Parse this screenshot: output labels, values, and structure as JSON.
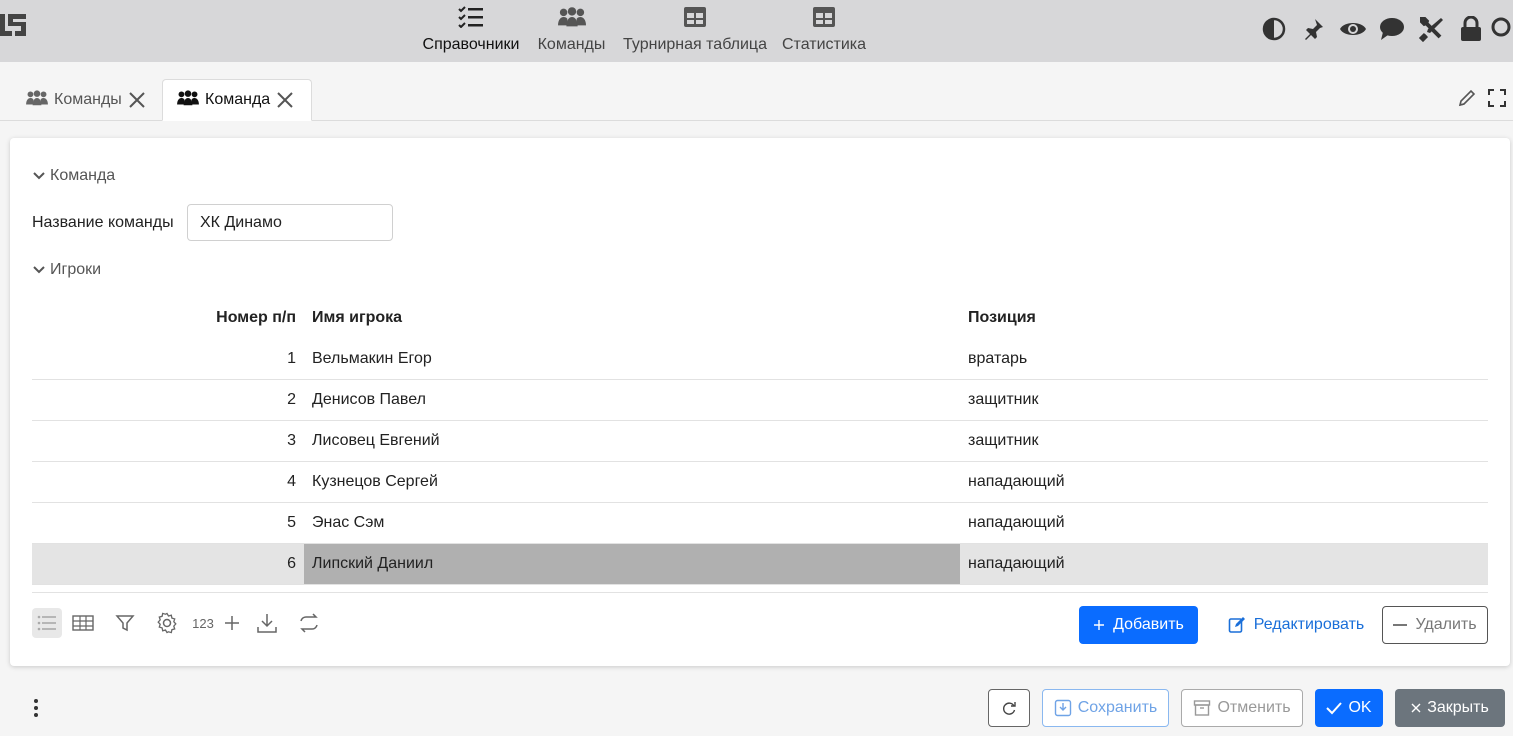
{
  "nav": [
    {
      "label": "Справочники",
      "icon": "checklist-icon",
      "active": true
    },
    {
      "label": "Команды",
      "icon": "users-icon",
      "active": false
    },
    {
      "label": "Турнирная таблица",
      "icon": "table-icon",
      "active": false
    },
    {
      "label": "Статистика",
      "icon": "table-icon",
      "active": false
    }
  ],
  "tools": [
    "contrast-icon",
    "pin-icon",
    "eye-icon",
    "comment-icon",
    "tools-icon",
    "lock-icon",
    "search-icon"
  ],
  "tabs": [
    {
      "label": "Команды",
      "active": false
    },
    {
      "label": "Команда",
      "active": true
    }
  ],
  "form": {
    "section_team": "Команда",
    "team_name_label": "Название команды",
    "team_name_value": "ХК Динамо",
    "section_players": "Игроки"
  },
  "grid": {
    "columns": [
      "Номер п/п",
      "Имя игрока",
      "Позиция"
    ],
    "rows": [
      {
        "num": "1",
        "name": "Вельмакин Егор",
        "position": "вратарь"
      },
      {
        "num": "2",
        "name": "Денисов Павел",
        "position": "защитник"
      },
      {
        "num": "3",
        "name": "Лисовец Евгений",
        "position": "защитник"
      },
      {
        "num": "4",
        "name": "Кузнецов Сергей",
        "position": "нападающий"
      },
      {
        "num": "5",
        "name": "Энас Сэм",
        "position": "нападающий"
      },
      {
        "num": "6",
        "name": "Липский Даниил",
        "position": "нападающий"
      }
    ],
    "selected_row": 5,
    "toolbar_count_label": "123"
  },
  "buttons": {
    "add": "Добавить",
    "edit": "Редактировать",
    "delete": "Удалить"
  },
  "footer": {
    "save": "Сохранить",
    "cancel": "Отменить",
    "ok": "OK",
    "close": "Закрыть"
  },
  "colors": {
    "primary": "#0a6cff",
    "topbar": "#d7d7d9",
    "selected_row": "#e4e4e4",
    "selected_cell": "#b0b0b0",
    "close_button": "#6c757d"
  }
}
